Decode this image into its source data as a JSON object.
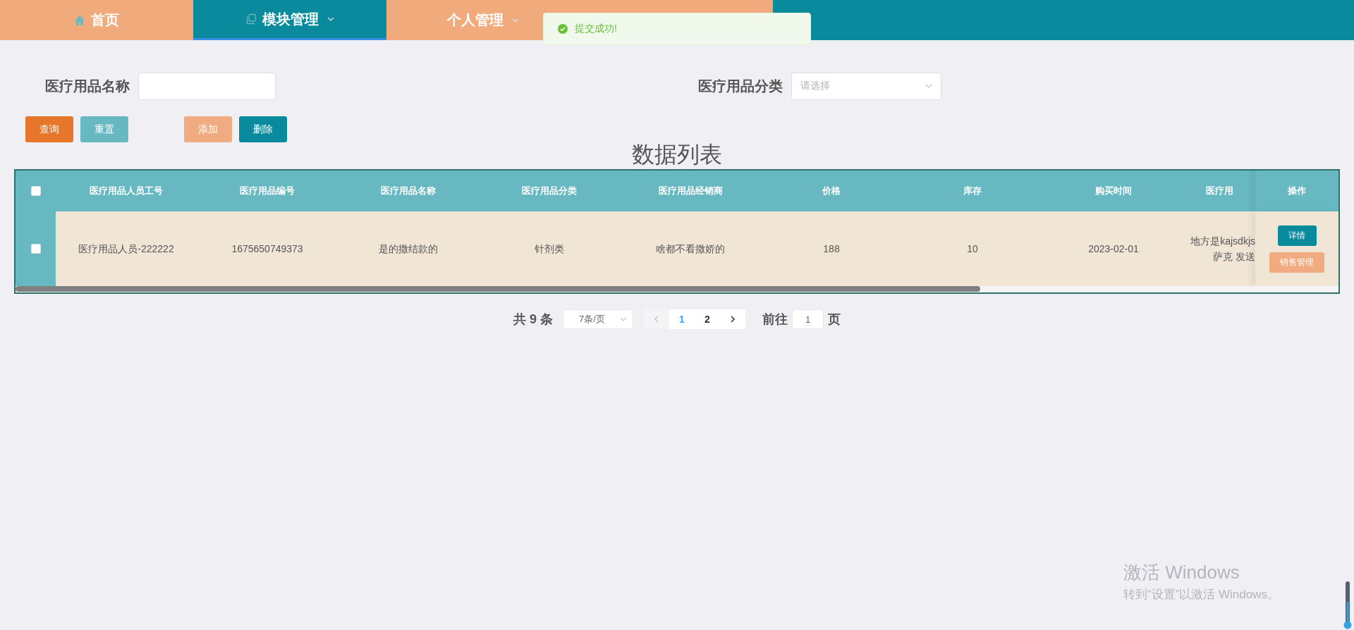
{
  "nav": {
    "tabs": [
      {
        "label": "首页",
        "kind": "home",
        "selected": false,
        "caret": false
      },
      {
        "label": "模块管理",
        "kind": "module",
        "selected": true,
        "caret": true
      },
      {
        "label": "个人管理",
        "kind": "plain",
        "selected": false,
        "caret": true
      }
    ]
  },
  "toast": {
    "kind": "success",
    "message": "提交成功!"
  },
  "search": {
    "fields": [
      {
        "label": "医疗用品名称",
        "kind": "input"
      },
      {
        "label": "医疗用品分类",
        "kind": "select",
        "placeholder": "请选择"
      }
    ]
  },
  "buttons": [
    {
      "label": "查询",
      "kind": "search"
    },
    {
      "label": "重置",
      "kind": "reset"
    },
    {
      "label": "添加",
      "kind": "add"
    },
    {
      "label": "删除",
      "kind": "delete"
    }
  ],
  "table": {
    "title": "数据列表",
    "select_all_checked": false,
    "columns": [
      "医疗用品人员工号",
      "医疗用品编号",
      "医疗用品名称",
      "医疗用品分类",
      "医疗用品经销商",
      "价格",
      "库存",
      "购买时间",
      "医疗用",
      "操作"
    ],
    "rows": [
      {
        "checked": false,
        "cells": [
          "医疗用品人员-222222",
          "1675650749373",
          "是的撒结款的",
          "针剂类",
          "啥都不看撒娇的",
          "188",
          "10",
          "2023-02-01",
          "地方是kajsdkjs\n萨克 发送"
        ],
        "actions": [
          {
            "label": "详情",
            "kind": "detail"
          },
          {
            "label": "销售管理",
            "kind": "sales"
          }
        ]
      }
    ]
  },
  "pagination": {
    "total": "共 9 条",
    "page_size": "7条/页",
    "prev_disabled": true,
    "pages": [
      {
        "label": "1",
        "selected": true
      },
      {
        "label": "2",
        "selected": false
      }
    ],
    "goto_label": "前往",
    "goto_value": "1",
    "goto_suffix": "页"
  },
  "os_notice": {
    "title": "激活 Windows",
    "message": "转到“设置”以激活 Windows。"
  }
}
